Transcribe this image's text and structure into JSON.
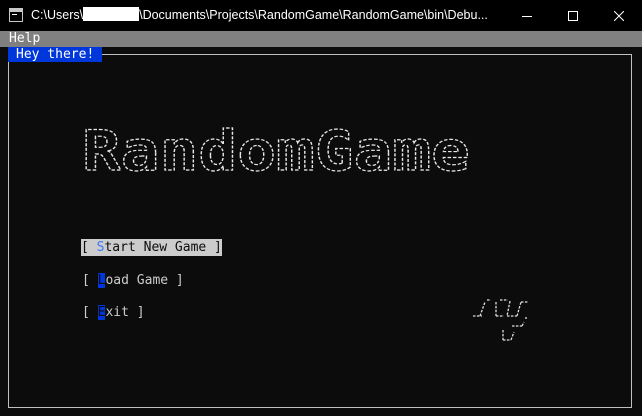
{
  "window": {
    "title_prefix": "C:\\Users\\",
    "title_suffix": "\\Documents\\Projects\\RandomGame\\RandomGame\\bin\\Debu..."
  },
  "menubar": {
    "help_label": "Help"
  },
  "frame": {
    "title": "Hey there!"
  },
  "logo": {
    "text": "RandomGame"
  },
  "menu": {
    "start": {
      "open": "[ ",
      "hotkey": "S",
      "rest": "tart New Game",
      "close": " ]"
    },
    "load": {
      "open": "[ ",
      "hotkey": "L",
      "rest": "oad Game",
      "close": " ]"
    },
    "exit": {
      "open": "[ ",
      "hotkey": "E",
      "rest": "xit",
      "close": " ]"
    }
  },
  "colors": {
    "background": "#0c0c0c",
    "text": "#cccccc",
    "selection": "#cccccc",
    "hotkey_blue": "#0037da",
    "hotkey_light_blue": "#3b78ff",
    "menubar": "#808080"
  },
  "icons": {
    "app": "console-icon",
    "minimize": "minimize-icon",
    "maximize": "maximize-icon",
    "close": "close-icon"
  }
}
